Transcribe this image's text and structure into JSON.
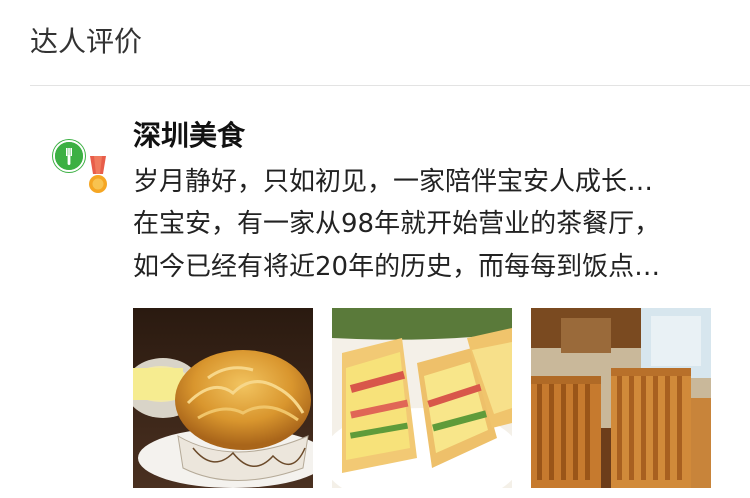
{
  "section": {
    "title": "达人评价"
  },
  "review": {
    "author_name": "深圳美食",
    "avatar_icon": "fork-knife-icon",
    "badge_icon": "medal-icon",
    "lines": [
      "岁月静好，只如初见，一家陪伴宝安人成长…",
      "在宝安，有一家从98年就开始营业的茶餐厅，",
      "如今已经有将近20年的历史，而每每到饭点…"
    ],
    "photos": [
      {
        "icon": "pineapple-bun-photo"
      },
      {
        "icon": "sandwich-photo"
      },
      {
        "icon": "restaurant-chairs-photo"
      }
    ]
  },
  "colors": {
    "avatar_green": "#3cb043",
    "medal_gold": "#f5a623",
    "medal_ribbon": "#e85d4a"
  }
}
